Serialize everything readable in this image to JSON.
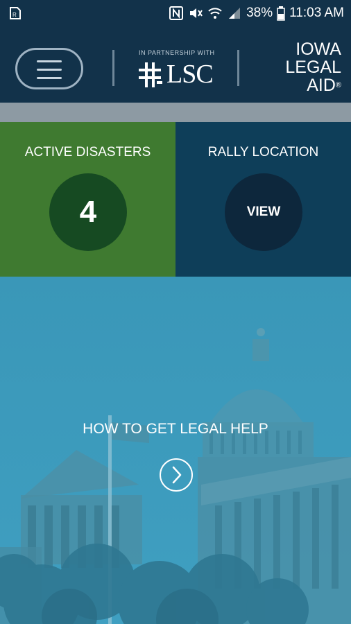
{
  "status_bar": {
    "battery": "38%",
    "time": "11:03 AM",
    "icons": [
      "sim-icon",
      "nfc-icon",
      "mute-icon",
      "wifi-icon",
      "signal-icon",
      "battery-icon"
    ]
  },
  "header": {
    "partner_caption": "IN PARTNERSHIP WITH",
    "partner_name": "LSC",
    "brand_line1": "IOWA",
    "brand_line2": "LEGAL",
    "brand_line3": "AID",
    "brand_mark": "®"
  },
  "tiles": {
    "disasters": {
      "title": "ACTIVE DISASTERS",
      "value": "4",
      "color": "#3f7a30"
    },
    "rally": {
      "title": "RALLY LOCATION",
      "action": "VIEW",
      "color": "#0e3e59"
    }
  },
  "hero": {
    "title": "HOW TO GET LEGAL HELP",
    "icon": "chevron-right-icon",
    "overlay_color": "#3a9bbd"
  }
}
